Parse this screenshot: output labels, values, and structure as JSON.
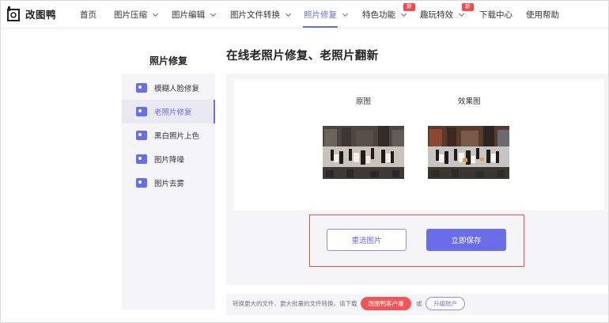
{
  "app": {
    "name": "改图鸭",
    "accent": "#6a6dea",
    "highlight": "#d9534f"
  },
  "nav": {
    "items": [
      {
        "label": "首页"
      },
      {
        "label": "图片压缩"
      },
      {
        "label": "图片编辑"
      },
      {
        "label": "图片文件转换"
      },
      {
        "label": "照片修复"
      },
      {
        "label": "特色功能"
      },
      {
        "label": "趣玩特效"
      },
      {
        "label": "下载中心"
      },
      {
        "label": "使用帮助"
      }
    ],
    "badge_new": "新",
    "active": "照片修复"
  },
  "sidebar": {
    "title": "照片修复",
    "items": [
      {
        "label": "模糊人脸修复",
        "icon": "face-photo-icon"
      },
      {
        "label": "老照片修复",
        "icon": "old-photo-icon"
      },
      {
        "label": "黑白照片上色",
        "icon": "colorize-icon"
      },
      {
        "label": "图片降噪",
        "icon": "denoise-icon"
      },
      {
        "label": "图片去雾",
        "icon": "dehaze-icon"
      }
    ],
    "active": "老照片修复"
  },
  "main": {
    "title": "在线老照片修复、老照片翻新",
    "original_label": "原图",
    "result_label": "效果图",
    "reselect_button": "重选图片",
    "save_button": "立即保存"
  },
  "footer": {
    "notice": "转换更大的文件、更大批量的文件转换，请下载",
    "client_button": "改图鸭客户端",
    "or": "或",
    "upgrade_button": "升级账户"
  }
}
